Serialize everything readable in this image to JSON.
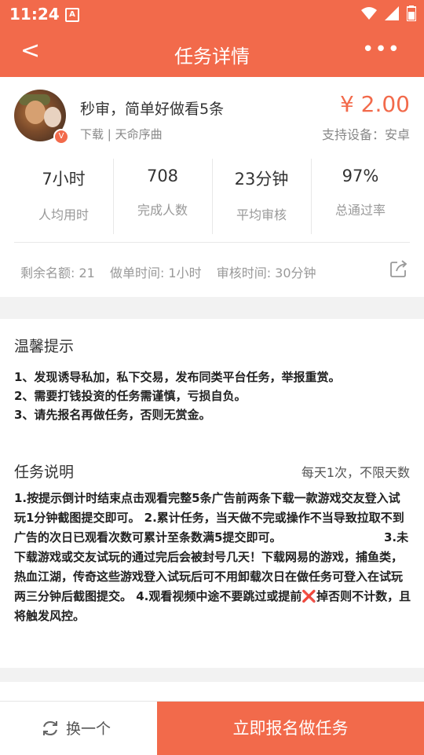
{
  "status_bar": {
    "time": "11:24",
    "badge": "A"
  },
  "nav": {
    "back": "<",
    "title": "任务详情",
    "more": "•••"
  },
  "task": {
    "name": "秒审，简单好做看5条",
    "sub": "下载 | 天命序曲",
    "price": "¥ 2.00",
    "device": "支持设备：安卓"
  },
  "stats": [
    {
      "value": "7小时",
      "label": "人均用时"
    },
    {
      "value": "708",
      "label": "完成人数"
    },
    {
      "value": "23分钟",
      "label": "平均审核"
    },
    {
      "value": "97%",
      "label": "总通过率"
    }
  ],
  "meta": {
    "remaining": "剩余名额: 21",
    "do_time": "做单时间: 1小时",
    "review_time": "审核时间: 30分钟"
  },
  "tips": {
    "title": "温馨提示",
    "lines": [
      "1、发现诱导私加，私下交易，发布同类平台任务，举报重赏。",
      "2、需要打钱投资的任务需谨慎，亏损自负。",
      "3、请先报名再做任务，否则无赏金。"
    ]
  },
  "description": {
    "title": "任务说明",
    "frequency": "每天1次，不限天数",
    "body_a": "1.按提示倒计时结束点击观看完整5条广告前两条下载一款游戏交友登入试玩1分钟截图提交即可。 2.累计任务，当天做不完或操作不当导致拉取不到广告的次日已观看次数可累计至条数满5提交即可。                         3.未下载游戏或交友试玩的通过完后会被封号几天！下载网易的游戏，捕鱼类，热血江湖，传奇这些游戏登入试玩后可不用卸载次日在做任务可登入在试玩两三分钟后截图提交。 4.观看视频中途不要跳过或提前",
    "xmark": "❌",
    "body_b": "掉否则不计数，且将触发风控。"
  },
  "bottom": {
    "swap": "换一个",
    "apply": "立即报名做任务"
  },
  "colors": {
    "accent": "#f26a4b",
    "price": "#f26a4b"
  },
  "icons": [
    "back-icon",
    "more-icon",
    "share-icon",
    "refresh-icon",
    "wifi-icon",
    "signal-icon",
    "battery-icon"
  ]
}
